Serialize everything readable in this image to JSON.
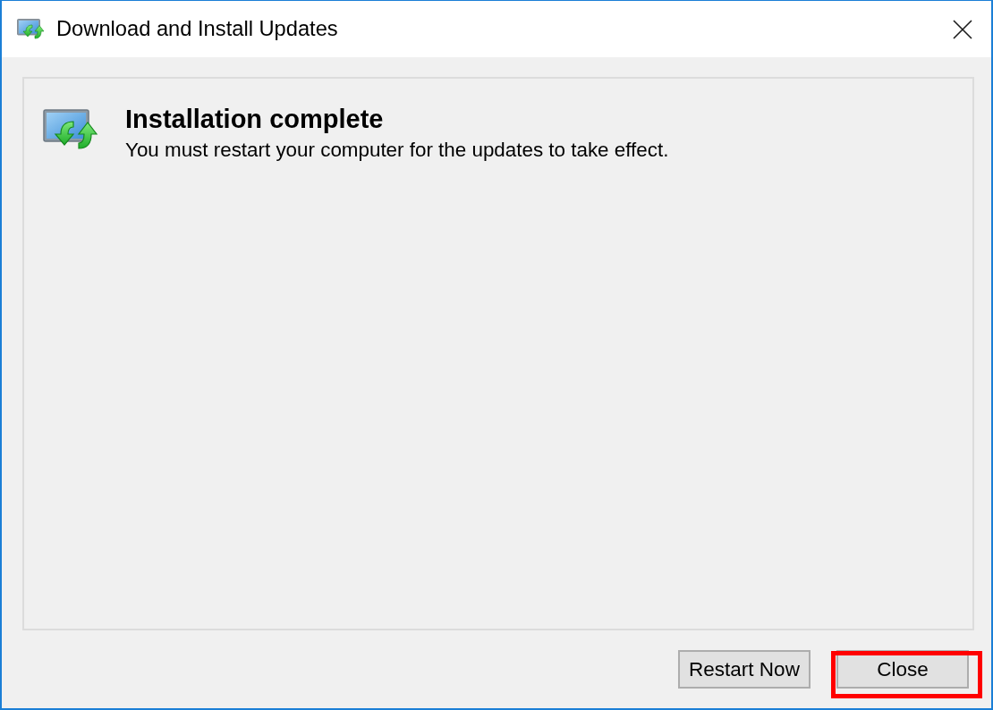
{
  "window": {
    "title": "Download and Install Updates"
  },
  "message": {
    "heading": "Installation complete",
    "text": "You must restart your computer for the updates to take effect."
  },
  "buttons": [
    {
      "label": "Restart Now",
      "highlighted": false
    },
    {
      "label": "Close",
      "highlighted": true
    }
  ]
}
